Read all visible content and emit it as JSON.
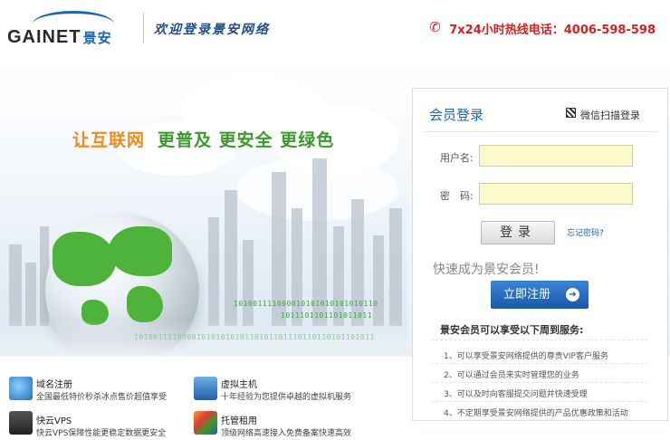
{
  "header": {
    "logo_text": "GAINET",
    "logo_cn": "景安",
    "welcome": "欢迎登录景安网络",
    "hotline": "7x24小时热线电话：4006-598-598"
  },
  "banner": {
    "slogan_main": "让互联网",
    "slogan_rest": "更普及 更安全 更绿色",
    "binary": [
      "101001111000010101010101010110",
      "1011101101101011011",
      "10100111100001010101010110101101110110110101101011"
    ]
  },
  "login": {
    "title": "会员登录",
    "wechat": "微信扫描登录",
    "username_label": "用户名:",
    "password_label": "密　码:",
    "username_value": "",
    "password_value": "",
    "login_button": "登录",
    "forgot": "忘记密码?",
    "join_text": "快速成为景安会员!",
    "register_button": "立即注册",
    "register_arrow": "➔",
    "benefits_title": "景安会员可以享受以下周到服务:",
    "benefits": [
      "1、可以享受景安网络提供的尊贵VIP客户服务",
      "2、可以通过会员来实时管理您的业务",
      "3、可以及时向客服提交问题并快速受理",
      "4、不定期享受景安网络提供的产品优惠政策和活动"
    ]
  },
  "services": [
    {
      "title": "域名注册",
      "desc": "全国最低特价秒杀冰点售价超值享受",
      "icon": "domain-icon"
    },
    {
      "title": "虚拟主机",
      "desc": "十年经验为您提供卓越的虚拟机服务",
      "icon": "virtual-host-icon"
    },
    {
      "title": "快云VPS",
      "desc": "快云VPS保障性能更稳定数据更安全",
      "icon": "vps-icon"
    },
    {
      "title": "托管租用",
      "desc": "顶级网络高速接入免费备案快速高效",
      "icon": "hosting-icon"
    }
  ],
  "colors": {
    "brand_blue": "#1f64b0",
    "hotline_red": "#d82020",
    "slogan_orange": "#f08a1a",
    "slogan_green": "#3a9a2a"
  }
}
